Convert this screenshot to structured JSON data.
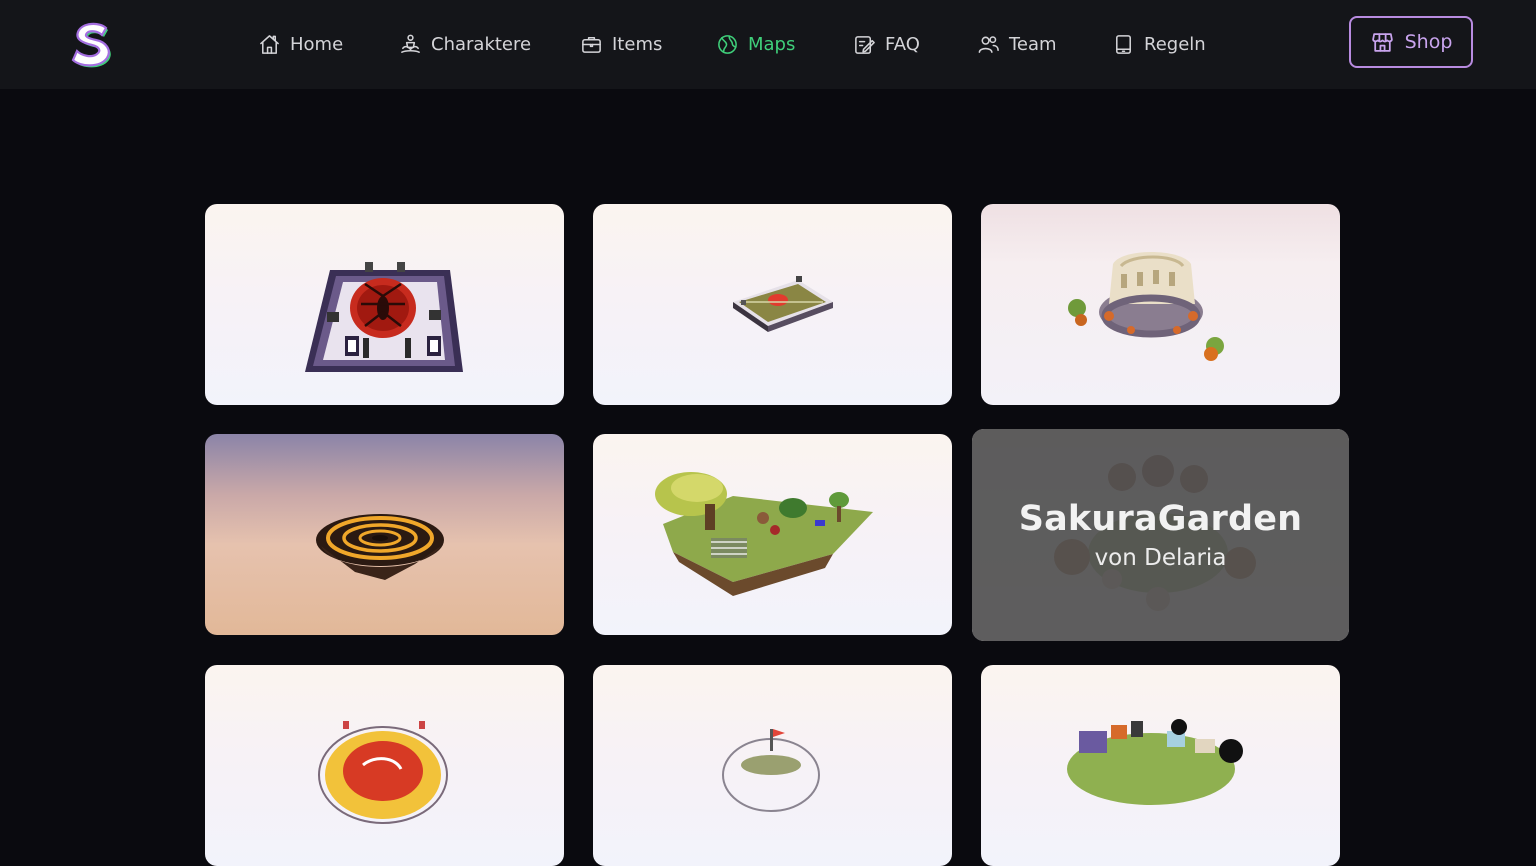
{
  "brand": {
    "logo_letter": "S",
    "accent": "#3fcf7a",
    "shop_color": "#c9a4ee"
  },
  "nav": {
    "items": [
      {
        "label": "Home",
        "icon": "home-icon",
        "active": false
      },
      {
        "label": "Charaktere",
        "icon": "character-icon",
        "active": false
      },
      {
        "label": "Items",
        "icon": "briefcase-icon",
        "active": false
      },
      {
        "label": "Maps",
        "icon": "globe-icon",
        "active": true
      },
      {
        "label": "FAQ",
        "icon": "note-edit-icon",
        "active": false
      },
      {
        "label": "Team",
        "icon": "users-icon",
        "active": false
      },
      {
        "label": "Regeln",
        "icon": "tablet-icon",
        "active": false
      }
    ],
    "shop_label": "Shop",
    "shop_icon": "store-icon"
  },
  "maps": {
    "hovered": {
      "title": "SakuraGarden",
      "author": "von Delaria"
    }
  }
}
